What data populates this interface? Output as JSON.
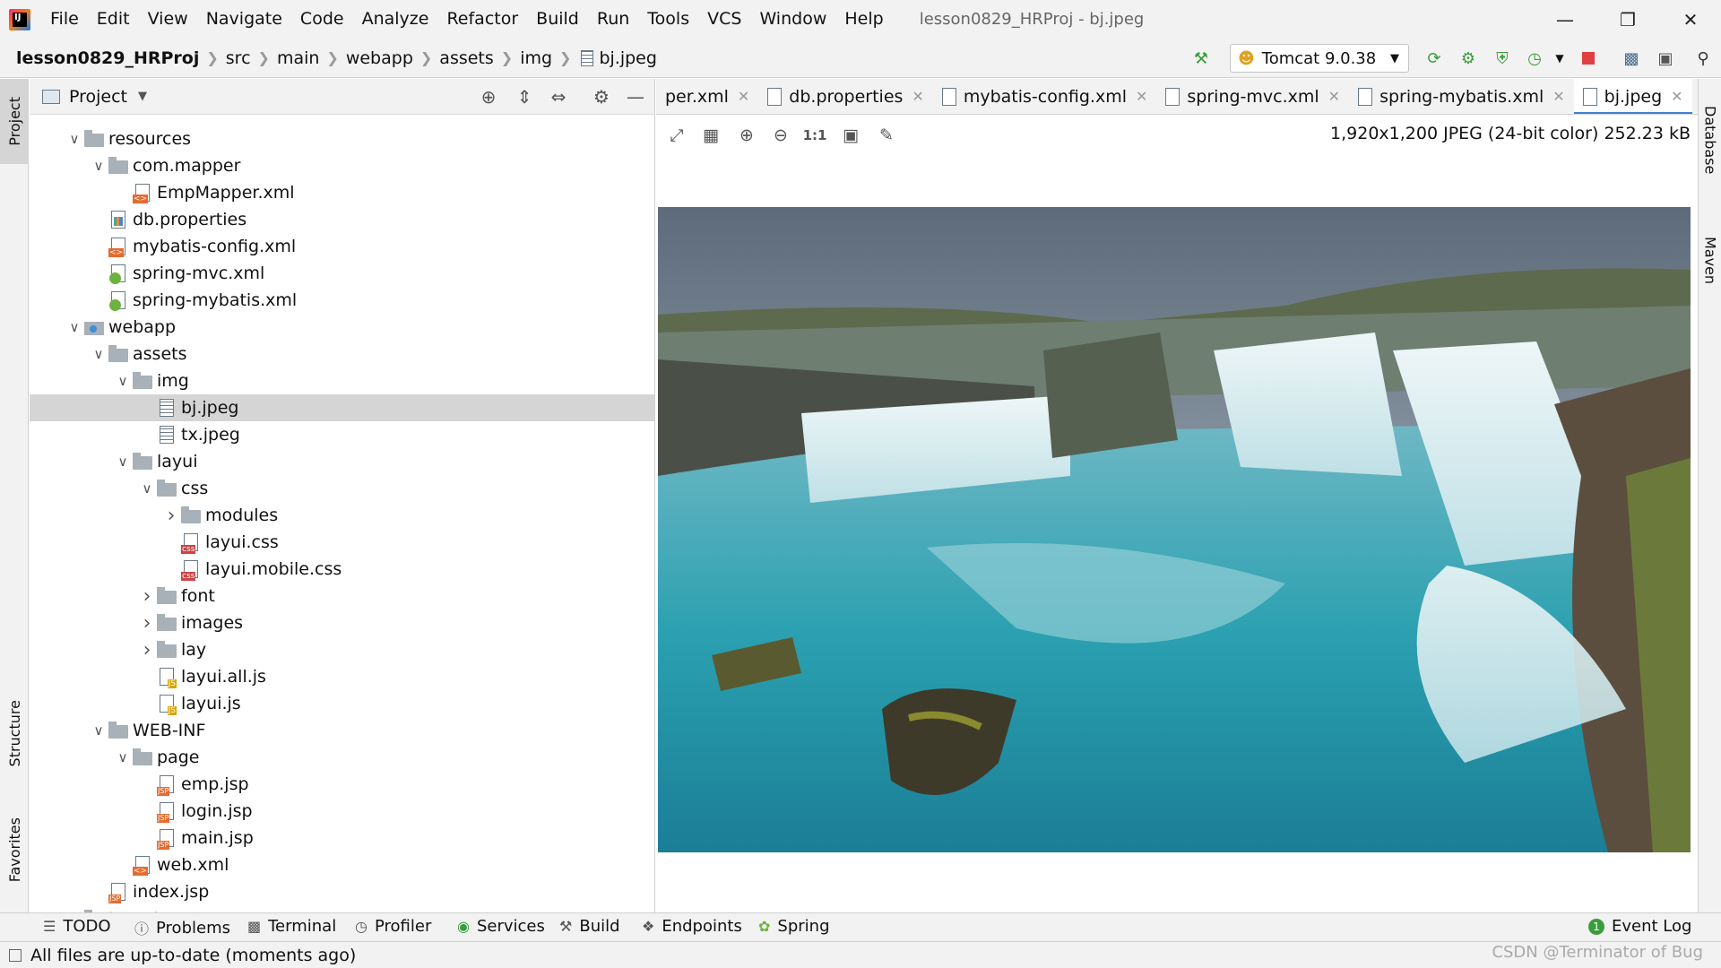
{
  "menubar": {
    "items": [
      "File",
      "Edit",
      "View",
      "Navigate",
      "Code",
      "Analyze",
      "Refactor",
      "Build",
      "Run",
      "Tools",
      "VCS",
      "Window",
      "Help"
    ],
    "window_title": "lesson0829_HRProj - bj.jpeg"
  },
  "navbar": {
    "breadcrumb": [
      "lesson0829_HRProj",
      "src",
      "main",
      "webapp",
      "assets",
      "img",
      "bj.jpeg"
    ],
    "run_config": "Tomcat 9.0.38"
  },
  "left_stripe": {
    "project": "Project",
    "structure": "Structure",
    "favorites": "Favorites"
  },
  "right_stripe": {
    "database": "Database",
    "maven": "Maven"
  },
  "project_panel": {
    "title": "Project",
    "tree": [
      {
        "label": "resources",
        "level": 1,
        "type": "folder",
        "arrow": "down"
      },
      {
        "label": "com.mapper",
        "level": 2,
        "type": "folder",
        "arrow": "down"
      },
      {
        "label": "EmpMapper.xml",
        "level": 3,
        "type": "xml",
        "arrow": ""
      },
      {
        "label": "db.properties",
        "level": 2,
        "type": "prop",
        "arrow": ""
      },
      {
        "label": "mybatis-config.xml",
        "level": 2,
        "type": "xml",
        "arrow": ""
      },
      {
        "label": "spring-mvc.xml",
        "level": 2,
        "type": "spring",
        "arrow": ""
      },
      {
        "label": "spring-mybatis.xml",
        "level": 2,
        "type": "spring",
        "arrow": ""
      },
      {
        "label": "webapp",
        "level": 1,
        "type": "webfolder",
        "arrow": "down"
      },
      {
        "label": "assets",
        "level": 2,
        "type": "folder",
        "arrow": "down"
      },
      {
        "label": "img",
        "level": 3,
        "type": "folder",
        "arrow": "down"
      },
      {
        "label": "bj.jpeg",
        "level": 4,
        "type": "img",
        "arrow": "",
        "selected": true
      },
      {
        "label": "tx.jpeg",
        "level": 4,
        "type": "img",
        "arrow": ""
      },
      {
        "label": "layui",
        "level": 3,
        "type": "folder",
        "arrow": "down"
      },
      {
        "label": "css",
        "level": 4,
        "type": "folder",
        "arrow": "down"
      },
      {
        "label": "modules",
        "level": 5,
        "type": "folder",
        "arrow": "right"
      },
      {
        "label": "layui.css",
        "level": 5,
        "type": "css",
        "arrow": ""
      },
      {
        "label": "layui.mobile.css",
        "level": 5,
        "type": "css",
        "arrow": ""
      },
      {
        "label": "font",
        "level": 4,
        "type": "folder",
        "arrow": "right"
      },
      {
        "label": "images",
        "level": 4,
        "type": "folder",
        "arrow": "right"
      },
      {
        "label": "lay",
        "level": 4,
        "type": "folder",
        "arrow": "right"
      },
      {
        "label": "layui.all.js",
        "level": 4,
        "type": "js",
        "arrow": ""
      },
      {
        "label": "layui.js",
        "level": 4,
        "type": "js",
        "arrow": ""
      },
      {
        "label": "WEB-INF",
        "level": 2,
        "type": "folder",
        "arrow": "down"
      },
      {
        "label": "page",
        "level": 3,
        "type": "folder",
        "arrow": "down"
      },
      {
        "label": "emp.jsp",
        "level": 4,
        "type": "jsp",
        "arrow": ""
      },
      {
        "label": "login.jsp",
        "level": 4,
        "type": "jsp",
        "arrow": ""
      },
      {
        "label": "main.jsp",
        "level": 4,
        "type": "jsp",
        "arrow": ""
      },
      {
        "label": "web.xml",
        "level": 3,
        "type": "xml",
        "arrow": ""
      },
      {
        "label": "index.jsp",
        "level": 2,
        "type": "jsp",
        "arrow": ""
      },
      {
        "label": "target",
        "level": 1,
        "type": "folder",
        "arrow": "right"
      }
    ]
  },
  "editor": {
    "tabs": [
      {
        "label": "per.xml",
        "active": false
      },
      {
        "label": "db.properties",
        "active": false
      },
      {
        "label": "mybatis-config.xml",
        "active": false
      },
      {
        "label": "spring-mvc.xml",
        "active": false
      },
      {
        "label": "spring-mybatis.xml",
        "active": false
      },
      {
        "label": "bj.jpeg",
        "active": true
      }
    ],
    "image_info": "1,920x1,200 JPEG (24-bit color) 252.23 kB",
    "zoom_actual_label": "1:1"
  },
  "bottom_tabs": [
    "TODO",
    "Problems",
    "Terminal",
    "Profiler",
    "Services",
    "Build",
    "Endpoints",
    "Spring"
  ],
  "event_log": "Event Log",
  "status_message": "All files are up-to-date (moments ago)",
  "watermark": "CSDN @Terminator of Bug",
  "colors": {
    "accent": "#4083c9",
    "selection": "#d5d5d5",
    "chrome": "#f2f2f2"
  }
}
